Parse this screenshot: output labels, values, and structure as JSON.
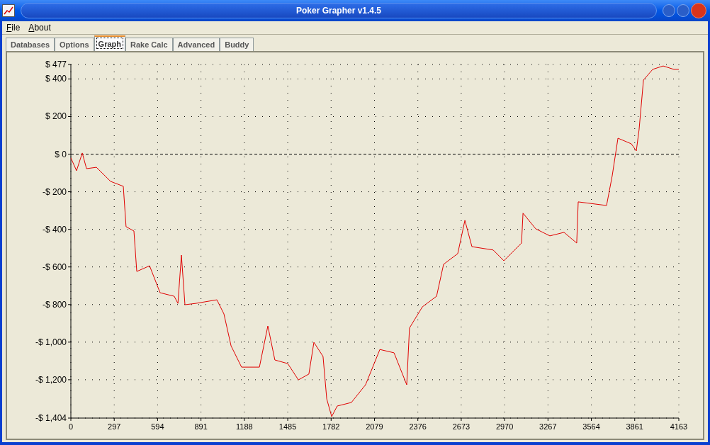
{
  "window": {
    "title": "Poker Grapher v1.4.5"
  },
  "menu": [
    "File",
    "About"
  ],
  "tabs": [
    {
      "label": "Databases",
      "selected": false
    },
    {
      "label": "Options",
      "selected": false
    },
    {
      "label": "Graph",
      "selected": true
    },
    {
      "label": "Rake Calc",
      "selected": false
    },
    {
      "label": "Advanced",
      "selected": false
    },
    {
      "label": "Buddy",
      "selected": false
    }
  ],
  "graph": {
    "chart_data": {
      "type": "line",
      "x": [
        0,
        39,
        78,
        107,
        175,
        272,
        359,
        378,
        432,
        451,
        539,
        611,
        708,
        733,
        757,
        781,
        854,
        1000,
        1048,
        1097,
        1169,
        1291,
        1349,
        1397,
        1485,
        1558,
        1630,
        1664,
        1727,
        1752,
        1786,
        1824,
        1921,
        2018,
        2116,
        2213,
        2300,
        2319,
        2407,
        2504,
        2552,
        2649,
        2698,
        2746,
        2892,
        2965,
        3086,
        3096,
        3183,
        3280,
        3377,
        3464,
        3474,
        3668,
        3707,
        3746,
        3838,
        3872,
        3891,
        3921,
        3984,
        4056,
        4129,
        4163
      ],
      "grid": true,
      "series": [
        {
          "color": "#e00000",
          "values": [
            -20,
            -88,
            6,
            -77,
            -70,
            -145,
            -171,
            -386,
            -409,
            -624,
            -594,
            -737,
            -756,
            -794,
            -537,
            -801,
            -794,
            -775,
            -850,
            -1020,
            -1133,
            -1133,
            -914,
            -1095,
            -1114,
            -1201,
            -1170,
            -1001,
            -1076,
            -1302,
            -1396,
            -1340,
            -1321,
            -1227,
            -1039,
            -1057,
            -1227,
            -925,
            -812,
            -756,
            -586,
            -529,
            -352,
            -492,
            -510,
            -567,
            -473,
            -314,
            -397,
            -435,
            -416,
            -473,
            -254,
            -273,
            -115,
            85,
            55,
            17,
            130,
            394,
            451,
            469,
            451,
            451
          ]
        }
      ],
      "xlim": [
        0,
        4163
      ],
      "ylim": [
        -1404,
        477
      ],
      "xticks": [
        0,
        297,
        594,
        891,
        1188,
        1485,
        1782,
        2079,
        2376,
        2673,
        2970,
        3267,
        3564,
        3861,
        4163
      ],
      "yticks": [
        {
          "value": 477,
          "label": "$ 477"
        },
        {
          "value": 400,
          "label": "$ 400"
        },
        {
          "value": 200,
          "label": "$ 200"
        },
        {
          "value": 0,
          "label": "$ 0"
        },
        {
          "value": -200,
          "label": "-$ 200"
        },
        {
          "value": -400,
          "label": "-$ 400"
        },
        {
          "value": -600,
          "label": "-$ 600"
        },
        {
          "value": -800,
          "label": "-$ 800"
        },
        {
          "value": -1000,
          "label": "-$ 1,000"
        },
        {
          "value": -1200,
          "label": "-$ 1,200"
        },
        {
          "value": -1404,
          "label": "-$ 1,404"
        }
      ]
    }
  }
}
